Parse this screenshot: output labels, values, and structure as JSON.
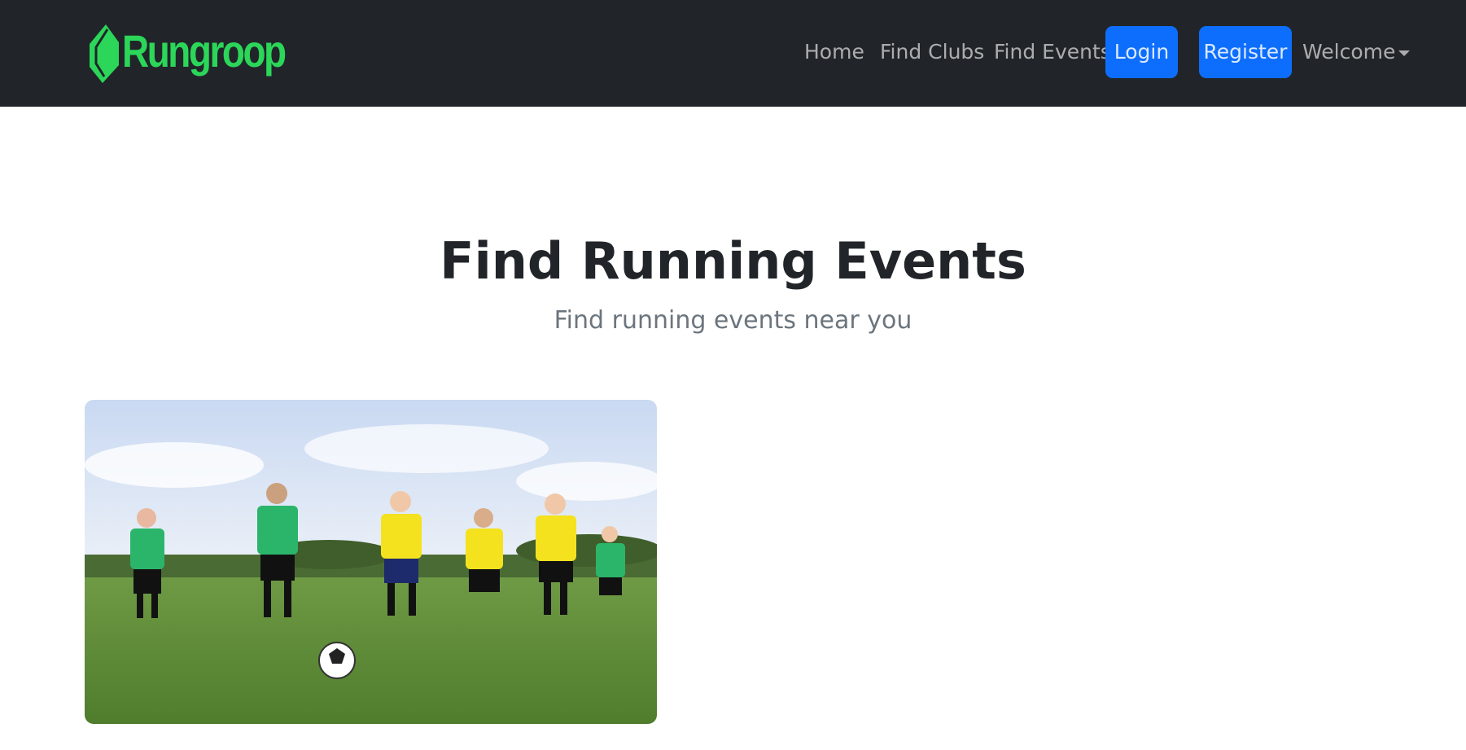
{
  "brand": {
    "name": "Rungroop",
    "color": "#2bd659"
  },
  "nav": {
    "home": "Home",
    "find_clubs": "Find Clubs",
    "find_events": "Find Events",
    "login": "Login",
    "register": "Register",
    "welcome": "Welcome"
  },
  "hero": {
    "title": "Find Running Events",
    "subtitle": "Find running events near you"
  },
  "colors": {
    "navbar_bg": "#212529",
    "primary_button": "#0d6efd",
    "brand_green": "#2bd659"
  },
  "event_card": {
    "image_semantic": "kids-soccer-photo"
  }
}
